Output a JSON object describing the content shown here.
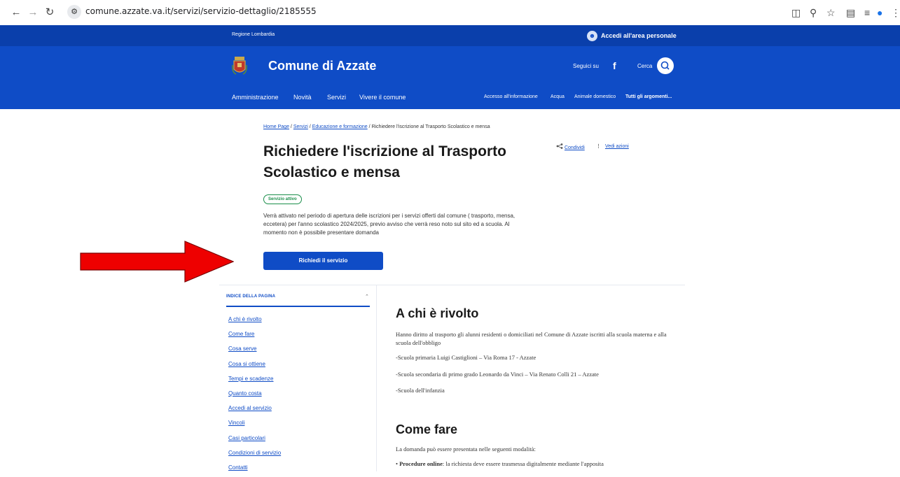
{
  "browser": {
    "url": "comune.azzate.va.it/servizi/servizio-dettaglio/2185555",
    "back_icon": "arrow-left-icon",
    "forward_icon": "arrow-right-icon",
    "reload_icon": "reload-icon"
  },
  "header": {
    "region_label": "Regione Lombardia",
    "login_label": "Accedi all'area personale",
    "town_name": "Comune di Azzate",
    "follow_label": "Seguici su",
    "facebook_glyph": "f",
    "search_label": "Cerca",
    "main_nav": [
      "Amministrazione",
      "Novità",
      "Servizi",
      "Vivere il comune"
    ],
    "sub_nav": [
      "Accesso all'informazione",
      "Acqua",
      "Animale domestico",
      "Tutti gli argomenti..."
    ]
  },
  "breadcrumb": {
    "items": [
      "Home Page",
      "Servizi",
      "Educazione e formazione"
    ],
    "current": "Richiedere l'iscrizione al Trasporto Scolastico e mensa",
    "sep": "/"
  },
  "page": {
    "title_line1": "Richiedere l'iscrizione al Trasporto",
    "title_line2": "Scolastico e mensa",
    "share_label": "Condividi",
    "actions_label": "Vedi azioni",
    "status_badge": "Servizio attivo",
    "description": "Verrà attivato nel periodo di apertura delle iscrizioni per i servizi offerti dal comune ( trasporto, mensa, eccetera) per l'anno scolastico 2024/2025, previo avviso che verrà reso noto sul sito ed a scuola. Al momento non è possibile presentare domanda",
    "cta_label": "Richiedi il servizio"
  },
  "index": {
    "heading": "INDICE DELLA PAGINA",
    "items": [
      "A chi è rivolto",
      "Come fare",
      "Cosa serve",
      "Cosa si ottiene",
      "Tempi e scadenze",
      "Quanto costa",
      "Accedi al servizio",
      "Vincoli",
      "Casi particolari",
      "Condizioni di servizio",
      "Contatti"
    ]
  },
  "sections": {
    "a_chi": {
      "title": "A chi è rivolto",
      "paragraphs": [
        "Hanno diritto al trasporto gli alunni residenti o domiciliati nel Comune di Azzate iscritti alla scuola materna e alla scuola dell'obbligo",
        "-Scuola primaria Luigi Castiglioni – Via Roma 17 - Azzate",
        "-Scuola secondaria di primo grado Leonardo da Vinci – Via Renato Colli 21 – Azzate",
        "-Scuola dell'infanzia"
      ]
    },
    "come_fare": {
      "title": "Come fare",
      "intro": "La domanda può essere presentata nelle seguenti modalità:",
      "bullet_bold": "Procedure online",
      "bullet_text": ": la richiesta deve essere trasmessa digitalmente mediante l'apposita"
    }
  },
  "colors": {
    "brand_blue": "#0f4cc6",
    "active_green": "#1a8e4a",
    "annotation_red": "#ee0000"
  }
}
